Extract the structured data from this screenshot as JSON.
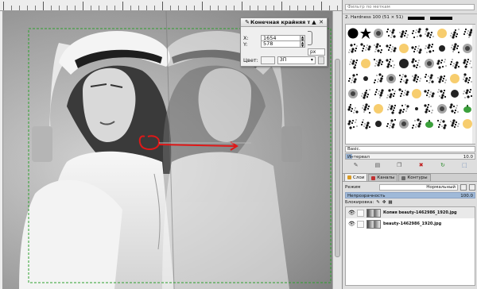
{
  "dialog": {
    "title": "Конечная крайняя точка",
    "x_label": "X:",
    "x_value": "1654",
    "y_label": "Y:",
    "y_value": "578",
    "unit": "px",
    "color_label": "Цвет:",
    "color_value": "ЗП"
  },
  "brushes": {
    "filter_placeholder": "Фильтр по меткам",
    "current_brush": "2. Hardness 100 (51 × 51)",
    "preset": "Basic.",
    "spacing_label": "Интервал",
    "spacing_value": "10.0"
  },
  "layers": {
    "tabs": [
      "Слои",
      "Каналы",
      "Контуры"
    ],
    "mode_label": "Режим",
    "mode_value": "Нормальный",
    "opacity_label": "Непрозрачность",
    "opacity_value": "100.0",
    "lock_label": "Блокировка:",
    "items": [
      {
        "name": "Копия beauty-1462986_1920.jpg"
      },
      {
        "name": "beauty-1462986_1920.jpg"
      }
    ]
  },
  "annotation_color": "#e01818",
  "selection_color": "#2da02d"
}
